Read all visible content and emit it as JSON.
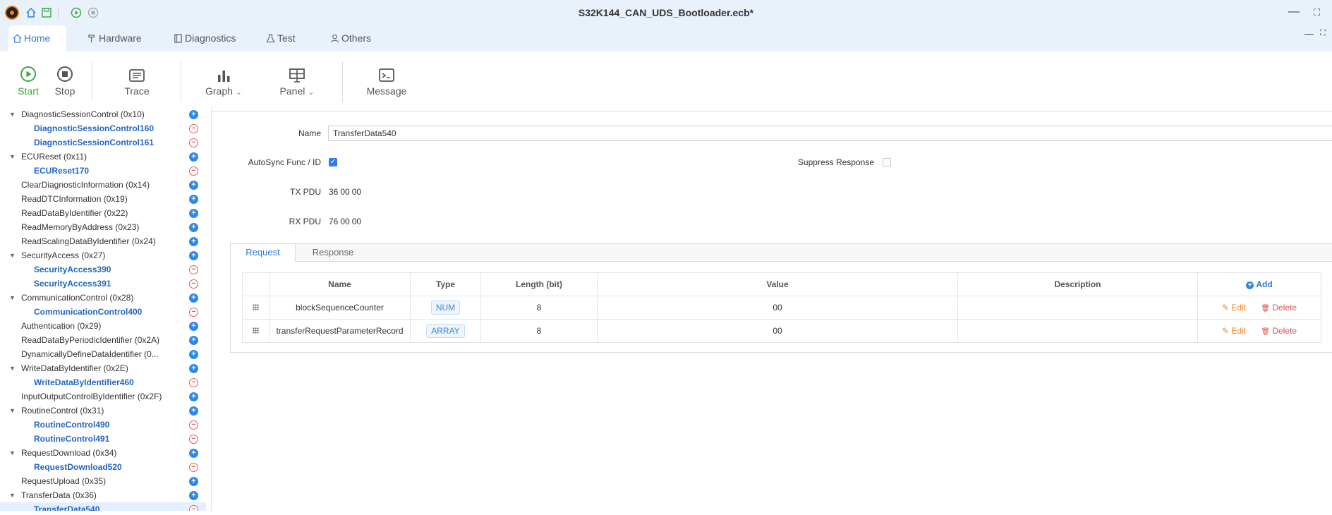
{
  "window": {
    "title": "S32K144_CAN_UDS_Bootloader.ecb*",
    "controls": [
      "—",
      "⛶"
    ]
  },
  "ribbon": {
    "tabs": [
      {
        "label": "Home",
        "icon": "home-gear-icon",
        "active": true
      },
      {
        "label": "Hardware",
        "icon": "hammer-icon"
      },
      {
        "label": "Diagnostics",
        "icon": "book-icon"
      },
      {
        "label": "Test",
        "icon": "flask-icon"
      },
      {
        "label": "Others",
        "icon": "user-icon"
      }
    ],
    "mini_controls": [
      "—",
      "⛶"
    ]
  },
  "toolbar": {
    "start_label": "Start",
    "stop_label": "Stop",
    "trace_label": "Trace",
    "graph_label": "Graph",
    "panel_label": "Panel",
    "message_label": "Message",
    "dropdown_glyph": "⌄",
    "start_color": "#38a845"
  },
  "tree": {
    "items": [
      {
        "label": "DiagnosticSessionControl (0x10)",
        "type": "service",
        "expanded": true,
        "action": "add"
      },
      {
        "label": "DiagnosticSessionControl160",
        "type": "child",
        "action": "remove"
      },
      {
        "label": "DiagnosticSessionControl161",
        "type": "child",
        "action": "remove"
      },
      {
        "label": "ECUReset (0x11)",
        "type": "service",
        "expanded": true,
        "action": "add"
      },
      {
        "label": "ECUReset170",
        "type": "child",
        "action": "remove"
      },
      {
        "label": "ClearDiagnosticInformation (0x14)",
        "type": "service",
        "action": "add"
      },
      {
        "label": "ReadDTCInformation (0x19)",
        "type": "service",
        "action": "add"
      },
      {
        "label": "ReadDataByIdentifier (0x22)",
        "type": "service",
        "action": "add"
      },
      {
        "label": "ReadMemoryByAddress (0x23)",
        "type": "service",
        "action": "add"
      },
      {
        "label": "ReadScalingDataByIdentifier (0x24)",
        "type": "service",
        "action": "add"
      },
      {
        "label": "SecurityAccess (0x27)",
        "type": "service",
        "expanded": true,
        "action": "add"
      },
      {
        "label": "SecurityAccess390",
        "type": "child",
        "action": "remove"
      },
      {
        "label": "SecurityAccess391",
        "type": "child",
        "action": "remove"
      },
      {
        "label": "CommunicationControl (0x28)",
        "type": "service",
        "expanded": true,
        "action": "add"
      },
      {
        "label": "CommunicationControl400",
        "type": "child",
        "action": "remove"
      },
      {
        "label": "Authentication (0x29)",
        "type": "service",
        "action": "add"
      },
      {
        "label": "ReadDataByPeriodicIdentifier (0x2A)",
        "type": "service",
        "action": "add"
      },
      {
        "label": "DynamicallyDefineDataIdentifier (0...",
        "type": "service",
        "action": "add"
      },
      {
        "label": "WriteDataByIdentifier (0x2E)",
        "type": "service",
        "expanded": true,
        "action": "add"
      },
      {
        "label": "WriteDataByIdentifier460",
        "type": "child",
        "action": "remove"
      },
      {
        "label": "InputOutputControlByIdentifier (0x2F)",
        "type": "service",
        "action": "add"
      },
      {
        "label": "RoutineControl (0x31)",
        "type": "service",
        "expanded": true,
        "action": "add"
      },
      {
        "label": "RoutineControl490",
        "type": "child",
        "action": "remove"
      },
      {
        "label": "RoutineControl491",
        "type": "child",
        "action": "remove"
      },
      {
        "label": "RequestDownload (0x34)",
        "type": "service",
        "expanded": true,
        "action": "add"
      },
      {
        "label": "RequestDownload520",
        "type": "child",
        "action": "remove"
      },
      {
        "label": "RequestUpload (0x35)",
        "type": "service",
        "action": "add"
      },
      {
        "label": "TransferData (0x36)",
        "type": "service",
        "expanded": true,
        "action": "add"
      },
      {
        "label": "TransferData540",
        "type": "child",
        "action": "remove",
        "selected": true
      }
    ],
    "add_glyph": "+",
    "remove_glyph": "−",
    "expand_glyph": "▼"
  },
  "form": {
    "name_label": "Name",
    "name_value": "TransferData540",
    "autosync_label": "AutoSync Func / ID",
    "autosync_checked": true,
    "suppress_label": "Suppress Response",
    "suppress_checked": false,
    "tx_label": "TX PDU",
    "tx_bytes": [
      "36",
      "00",
      "00"
    ],
    "rx_label": "RX PDU",
    "rx_bytes": [
      "76",
      "00",
      "00"
    ],
    "check_glyph": "✓"
  },
  "subtabs": [
    {
      "label": "Request",
      "active": true
    },
    {
      "label": "Response"
    }
  ],
  "table": {
    "headers": {
      "name": "Name",
      "type": "Type",
      "length": "Length (bit)",
      "value": "Value",
      "description": "Description"
    },
    "add_label": "Add",
    "add_glyph": "+",
    "edit_label": "Edit",
    "edit_glyph": "✎",
    "delete_label": "Delete",
    "delete_glyph": "🗑",
    "rows": [
      {
        "name": "blockSequenceCounter",
        "type": "NUM",
        "length": "8",
        "value": "00",
        "description": ""
      },
      {
        "name": "transferRequestParameterRecord",
        "type": "ARRAY",
        "length": "8",
        "value": "00",
        "description": ""
      }
    ]
  }
}
